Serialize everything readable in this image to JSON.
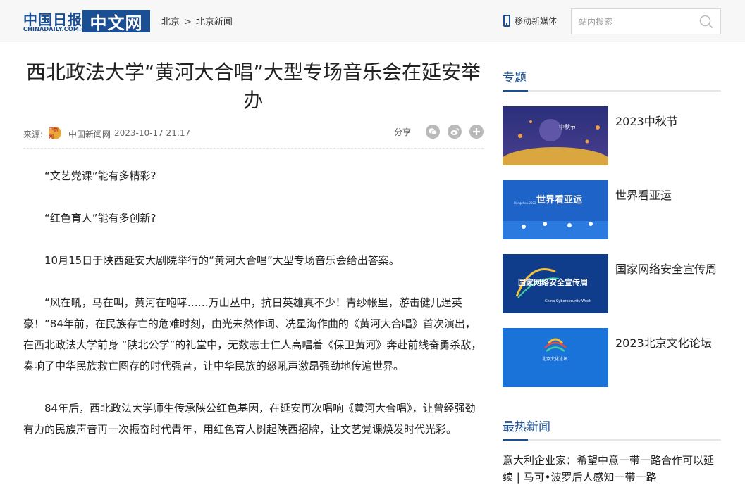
{
  "header": {
    "logo_cn": "中国日报",
    "logo_en": "CHINADAILY.COM.CN",
    "logo_zw": "中文网",
    "breadcrumb": [
      "北京",
      "北京新闻"
    ],
    "breadcrumb_sep": ">",
    "mobile_label": "移动新媒体",
    "search_placeholder": "站内搜索"
  },
  "article": {
    "title": "西北政法大学“黄河大合唱”大型专场音乐会在延安举办",
    "source_label": "来源:",
    "source_logo_text": "中新网",
    "source_name": "中国新闻网",
    "date": "2023-10-17 21:17",
    "share_label": "分享",
    "paragraphs": [
      "“文艺党课”能有多精彩?",
      "“红色育人”能有多创新?",
      "10月15日于陕西延安大剧院举行的“黄河大合唱”大型专场音乐会给出答案。",
      "“风在吼，马在叫，黄河在咆哮……万山丛中，抗日英雄真不少！青纱帐里，游击健儿逞英豪！”84年前，在民族存亡的危难时刻，由光未然作词、冼星海作曲的《黄河大合唱》首次演出，在西北政法大学前身 “陕北公学”的礼堂中，无数志士仁人高唱着《保卫黄河》奔赴前线奋勇杀敌，奏响了中华民族救亡图存的时代强音，让中华民族的怒吼声激昂强劲地传遍世界。",
      "84年后，西北政法大学师生传承陕公红色基因，在延安再次唱响《黄河大合唱》，让曾经强劲有力的民族声音再一次振奋时代青年，用红色育人树起陕西招牌，让文艺党课焕发时代光彩。"
    ]
  },
  "sidebar": {
    "topics_title": "专题",
    "topics": [
      {
        "name": "2023中秋节",
        "thumb_text": "中秋节"
      },
      {
        "name": "世界看亚运",
        "thumb_text": "世界看亚运",
        "thumb_sub": "Hangzhou 2022"
      },
      {
        "name": "国家网络安全宣传周",
        "thumb_text": "国家网络安全宣传周",
        "thumb_sub": "China Cybersecurity Week"
      },
      {
        "name": "2023北京文化论坛",
        "thumb_text": "北京文化论坛"
      }
    ],
    "hot_title": "最热新闻",
    "hot_items": [
      "意大利企业家：希望中意一带一路合作可以延续 | 马可•波罗后人感知一带一路"
    ]
  },
  "colors": {
    "brand_blue": "#1b4f94",
    "topbar_bg": "#f7f7f7",
    "share_icon_gray": "#b9b9b9"
  }
}
